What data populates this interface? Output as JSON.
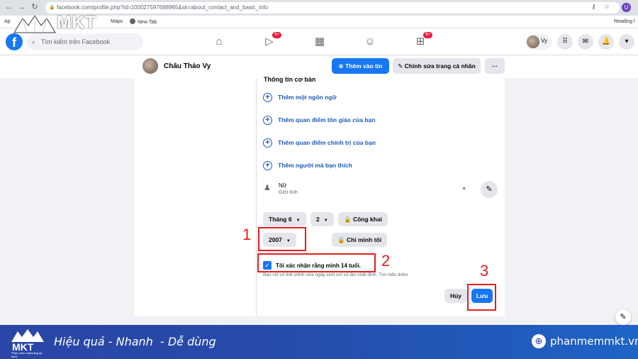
{
  "browser": {
    "url": "facebook.com/profile.php?id=100027597698965&sk=about_contact_and_basic_info",
    "user_initial": "U",
    "reading_list": "Reading l"
  },
  "bookmarks": [
    "Ap",
    "Maps",
    "New Tab"
  ],
  "brand": {
    "name": "MKT",
    "tagline": "Phần mềm marketing đa kênh",
    "footer_slogan": "Hiệu quả - Nhanh  - Dễ dùng",
    "website": "phanmemmkt.vn"
  },
  "fb_header": {
    "logo": "f",
    "search_placeholder": "Tìm kiếm trên Facebook",
    "watch_badge": "9+",
    "groups_badge": "9+",
    "profile_name": "Vy"
  },
  "profile": {
    "name": "Châu Thảo Vy",
    "add_story_label": "Thêm vào tin",
    "edit_profile_label": "Chỉnh sửa trang cá nhân",
    "more_label": "···"
  },
  "basic_info": {
    "section_title": "Thông tin cơ bản",
    "add_items": [
      "Thêm một ngôn ngữ",
      "Thêm quan điểm tôn giáo của bạn",
      "Thêm quan điểm chính trị của bạn",
      "Thêm người mà bạn thích"
    ],
    "gender_value": "Nữ",
    "gender_label": "Giới tính"
  },
  "birthday": {
    "month": "Tháng 6",
    "day": "2",
    "year": "2007",
    "date_privacy": "Công khai",
    "year_privacy": "Chỉ mình tôi",
    "confirm_text": "Tôi xác nhận rằng mình 14 tuổi.",
    "confirm_checked": true,
    "note": "Bạn chỉ có thể chỉnh sửa ngày sinh với số lần nhất định. Tìm hiểu thêm",
    "cancel_label": "Hủy",
    "save_label": "Lưu"
  },
  "annotations": [
    "1",
    "2",
    "3"
  ],
  "colors": {
    "facebook_blue": "#1877f2",
    "annotation_red": "#e02020",
    "footer_blue": "#2a46a8"
  }
}
